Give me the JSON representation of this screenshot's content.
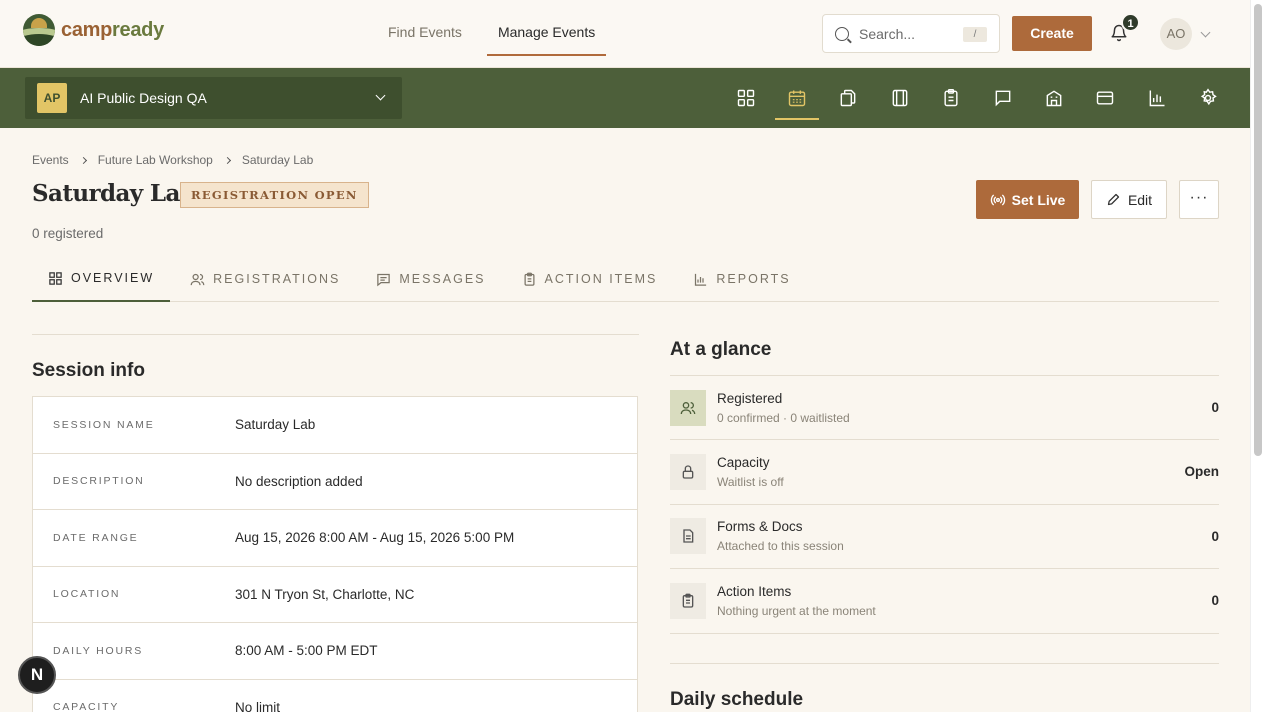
{
  "brand": {
    "name_part1": "camp",
    "name_part2": "ready"
  },
  "nav": {
    "links": [
      {
        "label": "Find Events"
      },
      {
        "label": "Manage Events"
      }
    ]
  },
  "search": {
    "placeholder": "Search...",
    "shortcut": "/"
  },
  "header": {
    "create_label": "Create",
    "notification_count": "1",
    "avatar_initials": "AO"
  },
  "org": {
    "badge": "AP",
    "name": "AI Public Design QA"
  },
  "toolbar_icons": [
    "grid-icon",
    "calendar-icon",
    "pages-icon",
    "book-icon",
    "clipboard-icon",
    "chat-icon",
    "building-icon",
    "card-icon",
    "bar-chart-icon",
    "settings-icon"
  ],
  "breadcrumb": [
    "Events",
    "Future Lab Workshop",
    "Saturday Lab"
  ],
  "page": {
    "title": "Saturday Lab",
    "status": "REGISTRATION OPEN",
    "registered": "0 registered",
    "set_live_label": "Set Live",
    "edit_label": "Edit",
    "more_label": "···"
  },
  "tabs": [
    {
      "label": "OVERVIEW"
    },
    {
      "label": "REGISTRATIONS"
    },
    {
      "label": "MESSAGES"
    },
    {
      "label": "ACTION ITEMS"
    },
    {
      "label": "REPORTS"
    }
  ],
  "session_info": {
    "title": "Session info",
    "rows": [
      {
        "label": "SESSION NAME",
        "value": "Saturday Lab"
      },
      {
        "label": "DESCRIPTION",
        "value": "No description added"
      },
      {
        "label": "DATE RANGE",
        "value": "Aug 15, 2026 8:00 AM - Aug 15, 2026 5:00 PM"
      },
      {
        "label": "LOCATION",
        "value": "301 N Tryon St, Charlotte, NC"
      },
      {
        "label": "DAILY HOURS",
        "value": "8:00 AM - 5:00 PM EDT"
      },
      {
        "label": "CAPACITY",
        "value": "No limit"
      }
    ]
  },
  "glance": {
    "title": "At a glance",
    "rows": [
      {
        "title": "Registered",
        "sub": "0 confirmed · 0 waitlisted",
        "value": "0"
      },
      {
        "title": "Capacity",
        "sub": "Waitlist is off",
        "value": "Open"
      },
      {
        "title": "Forms & Docs",
        "sub": "Attached to this session",
        "value": "0"
      },
      {
        "title": "Action Items",
        "sub": "Nothing urgent at the moment",
        "value": "0"
      }
    ]
  },
  "daily_schedule": {
    "title": "Daily schedule"
  },
  "dev_badge": "N",
  "colors": {
    "accent": "#ad6a3b",
    "forest": "#4d5f3a",
    "background": "#faf6ef",
    "gold": "#e2c566"
  }
}
